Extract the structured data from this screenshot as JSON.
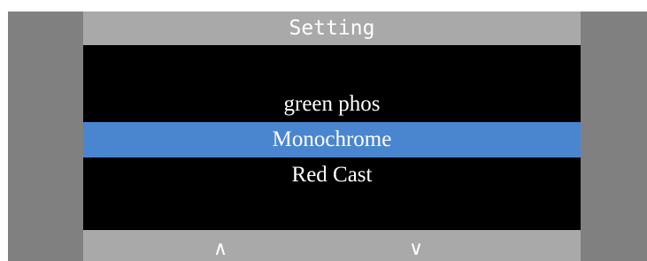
{
  "header": {
    "title": "Setting"
  },
  "menu": {
    "items": [
      {
        "label": "green phos"
      },
      {
        "label": "Monochrome"
      },
      {
        "label": "Red Cast"
      }
    ],
    "selected_index": 1,
    "selected_color": "#4a86d0"
  },
  "footer": {
    "up_glyph": "∧",
    "down_glyph": "∨",
    "up_icon": "chevron-up-icon",
    "down_icon": "chevron-down-icon"
  },
  "colors": {
    "bar_background": "#a9a9a9",
    "side_background": "#808080",
    "panel_background": "#000000",
    "text": "#ffffff"
  }
}
